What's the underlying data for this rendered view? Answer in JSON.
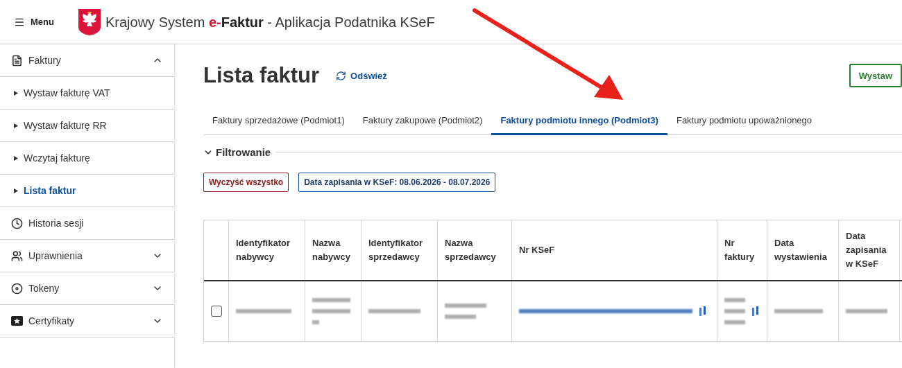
{
  "header": {
    "menu_label": "Menu",
    "title_parts": [
      {
        "kind": "plain",
        "text": "Krajowy System "
      },
      {
        "kind": "accent",
        "text": "e-"
      },
      {
        "kind": "strong",
        "text": "Faktur"
      },
      {
        "kind": "plain",
        "text": " - Aplikacja Podatnika KSeF"
      }
    ]
  },
  "sidebar": {
    "items": [
      {
        "kind": "section",
        "label": "Faktury",
        "expanded": true,
        "children": [
          {
            "label": "Wystaw fakturę VAT",
            "selected": false
          },
          {
            "label": "Wystaw fakturę RR",
            "selected": false
          },
          {
            "label": "Wczytaj fakturę",
            "selected": false
          },
          {
            "label": "Lista faktur",
            "selected": true
          }
        ]
      },
      {
        "kind": "link",
        "label": "Historia sesji"
      },
      {
        "kind": "section",
        "label": "Uprawnienia",
        "expanded": false
      },
      {
        "kind": "section",
        "label": "Tokeny",
        "expanded": false
      },
      {
        "kind": "section",
        "label": "Certyfikaty",
        "expanded": false
      }
    ]
  },
  "page": {
    "title": "Lista faktur",
    "refresh_label": "Odśwież",
    "primary_button": "Wystaw"
  },
  "tabs": [
    {
      "label": "Faktury sprzedażowe (Podmiot1)",
      "selected": false
    },
    {
      "label": "Faktury zakupowe (Podmiot2)",
      "selected": false
    },
    {
      "label": "Faktury podmiotu innego (Podmiot3)",
      "selected": true
    },
    {
      "label": "Faktury podmiotu upoważnionego",
      "selected": false
    }
  ],
  "filters": {
    "title": "Filtrowanie",
    "expanded": true,
    "chips": [
      {
        "kind": "clear",
        "label": "Wyczyść wszystko"
      },
      {
        "kind": "filter",
        "label": "Data zapisania w KSeF: 08.06.2026 - 08.07.2026"
      }
    ]
  },
  "table": {
    "columns": [
      "Identyfikator nabywcy",
      "Nazwa nabywcy",
      "Identyfikator sprzedawcy",
      "Nazwa sprzedawcy",
      "Nr KSeF",
      "Nr faktury",
      "Data wystawienia",
      "Data zapisania w KSeF"
    ],
    "rows": [
      {
        "checked": false
      }
    ]
  }
}
